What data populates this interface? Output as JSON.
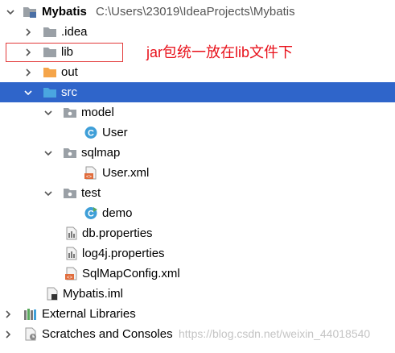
{
  "project": {
    "name": "Mybatis",
    "path": "C:\\Users\\23019\\IdeaProjects\\Mybatis"
  },
  "tree": {
    "idea": ".idea",
    "lib": "lib",
    "out": "out",
    "src": "src",
    "model": "model",
    "user": "User",
    "sqlmap": "sqlmap",
    "user_xml": "User.xml",
    "test": "test",
    "demo": "demo",
    "db_properties": "db.properties",
    "log4j_properties": "log4j.properties",
    "sqlmapconfig": "SqlMapConfig.xml",
    "iml": "Mybatis.iml",
    "external_libraries": "External Libraries",
    "scratches": "Scratches and Consoles"
  },
  "annotation": {
    "text": "jar包统一放在lib文件下",
    "color": "#e8101a"
  },
  "watermark": "https://blog.csdn.net/weixin_44018540",
  "colors": {
    "selection": "#2f65ca",
    "folder_gray": "#9aa0a6",
    "folder_orange": "#f5a54a",
    "folder_blue": "#4aa6e0",
    "class_icon": "#3f9fd8"
  }
}
